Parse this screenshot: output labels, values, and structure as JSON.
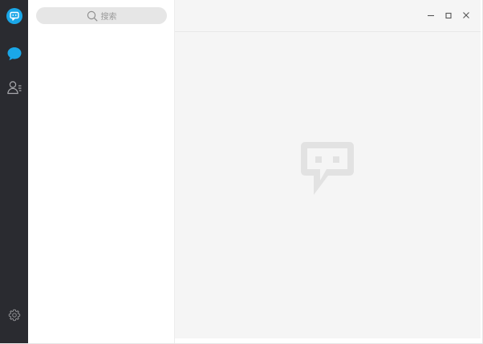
{
  "sidebar": {
    "items": [
      {
        "icon": "chat-bubble-logo-icon"
      },
      {
        "icon": "chat-bubble-icon",
        "active": true
      },
      {
        "icon": "contacts-icon"
      },
      {
        "icon": "gear-icon"
      }
    ]
  },
  "search": {
    "placeholder": "搜索",
    "icon": "search-icon"
  },
  "window_controls": {
    "minimize": "minimize-icon",
    "maximize": "maximize-icon",
    "close": "close-icon"
  },
  "main": {
    "empty_state_icon": "chat-bubble-placeholder-icon"
  },
  "colors": {
    "rail": "#2a2b30",
    "accent": "#1aa7e8",
    "main_bg": "#f5f5f5",
    "search_bg": "#e6e6e6"
  }
}
